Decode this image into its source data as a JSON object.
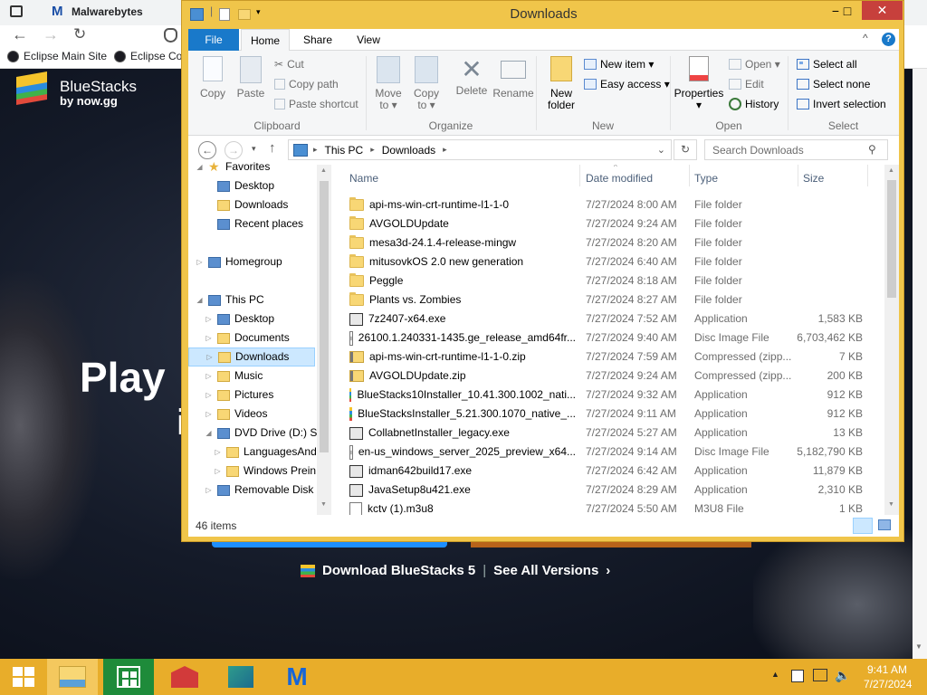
{
  "browser": {
    "tab_title": "Malwarebytes",
    "bookmarks": [
      "Eclipse Main Site",
      "Eclipse Co"
    ],
    "site_logo": {
      "name": "BlueStacks",
      "by": "by now.gg"
    },
    "hero_text": "Play",
    "hero_text2": "i",
    "download_link": "Download BlueStacks 5",
    "separator": "|",
    "versions_link": "See All Versions",
    "versions_chevron": "›"
  },
  "window": {
    "title": "Downloads",
    "controls": {
      "minimize": "−",
      "maximize": "□",
      "close": "✕"
    },
    "help": "?",
    "collapse": "^"
  },
  "ribbon": {
    "tabs": [
      "File",
      "Home",
      "Share",
      "View"
    ],
    "active_tab": "Home",
    "clipboard": {
      "copy": "Copy",
      "paste": "Paste",
      "cut": "Cut",
      "copy_path": "Copy path",
      "paste_shortcut": "Paste shortcut",
      "group": "Clipboard"
    },
    "organize": {
      "move_to": "Move",
      "move_to2": "to ▾",
      "copy_to": "Copy",
      "copy_to2": "to ▾",
      "delete": "Delete",
      "rename": "Rename",
      "group": "Organize"
    },
    "new": {
      "new_folder": "New",
      "new_folder2": "folder",
      "new_item": "New item ▾",
      "easy_access": "Easy access ▾",
      "group": "New"
    },
    "open": {
      "properties": "Properties",
      "properties_arrow": "▾",
      "open": "Open ▾",
      "edit": "Edit",
      "history": "History",
      "group": "Open"
    },
    "select": {
      "select_all": "Select all",
      "select_none": "Select none",
      "invert_selection": "Invert selection",
      "group": "Select"
    }
  },
  "address": {
    "path": [
      "This PC",
      "Downloads"
    ],
    "search_placeholder": "Search Downloads"
  },
  "nav_tree": [
    {
      "label": "Favorites",
      "indent": 0,
      "arrow": "◢",
      "icon": "star-icon"
    },
    {
      "label": "Desktop",
      "indent": 1,
      "arrow": "",
      "icon": "desktop-icon"
    },
    {
      "label": "Downloads",
      "indent": 1,
      "arrow": "",
      "icon": "downloads-folder-icon"
    },
    {
      "label": "Recent places",
      "indent": 1,
      "arrow": "",
      "icon": "recent-places-icon"
    },
    {
      "label": "Homegroup",
      "indent": 0,
      "arrow": "▷",
      "icon": "homegroup-icon"
    },
    {
      "label": "This PC",
      "indent": 0,
      "arrow": "◢",
      "icon": "computer-icon"
    },
    {
      "label": "Desktop",
      "indent": 1,
      "arrow": "▷",
      "icon": "desktop-icon"
    },
    {
      "label": "Documents",
      "indent": 1,
      "arrow": "▷",
      "icon": "documents-icon"
    },
    {
      "label": "Downloads",
      "indent": 1,
      "arrow": "▷",
      "icon": "downloads-folder-icon",
      "selected": true
    },
    {
      "label": "Music",
      "indent": 1,
      "arrow": "▷",
      "icon": "music-icon"
    },
    {
      "label": "Pictures",
      "indent": 1,
      "arrow": "▷",
      "icon": "pictures-icon"
    },
    {
      "label": "Videos",
      "indent": 1,
      "arrow": "▷",
      "icon": "videos-icon"
    },
    {
      "label": "DVD Drive (D:) SE",
      "indent": 1,
      "arrow": "◢",
      "icon": "dvd-drive-icon"
    },
    {
      "label": "LanguagesAnd",
      "indent": 2,
      "arrow": "▷",
      "icon": "folder-icon"
    },
    {
      "label": "Windows Prein",
      "indent": 2,
      "arrow": "▷",
      "icon": "folder-icon"
    },
    {
      "label": "Removable Disk (",
      "indent": 1,
      "arrow": "▷",
      "icon": "removable-disk-icon"
    }
  ],
  "columns": {
    "name": "Name",
    "date": "Date modified",
    "type": "Type",
    "size": "Size"
  },
  "files": [
    {
      "name": "api-ms-win-crt-runtime-l1-1-0",
      "date": "7/27/2024 8:00 AM",
      "type": "File folder",
      "size": "",
      "icon": "folder"
    },
    {
      "name": "AVGOLDUpdate",
      "date": "7/27/2024 9:24 AM",
      "type": "File folder",
      "size": "",
      "icon": "folder"
    },
    {
      "name": "mesa3d-24.1.4-release-mingw",
      "date": "7/27/2024 8:20 AM",
      "type": "File folder",
      "size": "",
      "icon": "folder"
    },
    {
      "name": "mitusovkOS 2.0 new generation",
      "date": "7/27/2024 6:40 AM",
      "type": "File folder",
      "size": "",
      "icon": "folder"
    },
    {
      "name": "Peggle",
      "date": "7/27/2024 8:18 AM",
      "type": "File folder",
      "size": "",
      "icon": "folder"
    },
    {
      "name": "Plants vs. Zombies",
      "date": "7/27/2024 8:27 AM",
      "type": "File folder",
      "size": "",
      "icon": "folder"
    },
    {
      "name": "7z2407-x64.exe",
      "date": "7/27/2024 7:52 AM",
      "type": "Application",
      "size": "1,583 KB",
      "icon": "app"
    },
    {
      "name": "26100.1.240331-1435.ge_release_amd64fr...",
      "date": "7/27/2024 9:40 AM",
      "type": "Disc Image File",
      "size": "6,703,462 KB",
      "icon": "disc"
    },
    {
      "name": "api-ms-win-crt-runtime-l1-1-0.zip",
      "date": "7/27/2024 7:59 AM",
      "type": "Compressed (zipp...",
      "size": "7 KB",
      "icon": "zip"
    },
    {
      "name": "AVGOLDUpdate.zip",
      "date": "7/27/2024 9:24 AM",
      "type": "Compressed (zipp...",
      "size": "200 KB",
      "icon": "zip"
    },
    {
      "name": "BlueStacks10Installer_10.41.300.1002_nati...",
      "date": "7/27/2024 9:32 AM",
      "type": "Application",
      "size": "912 KB",
      "icon": "bluestacks"
    },
    {
      "name": "BlueStacksInstaller_5.21.300.1070_native_...",
      "date": "7/27/2024 9:11 AM",
      "type": "Application",
      "size": "912 KB",
      "icon": "bluestacks"
    },
    {
      "name": "CollabnetInstaller_legacy.exe",
      "date": "7/27/2024 5:27 AM",
      "type": "Application",
      "size": "13 KB",
      "icon": "app"
    },
    {
      "name": "en-us_windows_server_2025_preview_x64...",
      "date": "7/27/2024 9:14 AM",
      "type": "Disc Image File",
      "size": "5,182,790 KB",
      "icon": "disc"
    },
    {
      "name": "idman642build17.exe",
      "date": "7/27/2024 6:42 AM",
      "type": "Application",
      "size": "11,879 KB",
      "icon": "app"
    },
    {
      "name": "JavaSetup8u421.exe",
      "date": "7/27/2024 8:29 AM",
      "type": "Application",
      "size": "2,310 KB",
      "icon": "app"
    },
    {
      "name": "kctv (1).m3u8",
      "date": "7/27/2024 5:50 AM",
      "type": "M3U8 File",
      "size": "1 KB",
      "icon": "file"
    }
  ],
  "status": {
    "items": "46 items"
  },
  "taskbar": {
    "apps": [
      "start-button",
      "file-explorer-icon",
      "store-icon",
      "app-red-icon",
      "app-teal-icon",
      "malwarebytes-icon"
    ],
    "time": "9:41 AM",
    "date": "7/27/2024"
  },
  "colors": {
    "accent": "#1979ca",
    "window_frame": "#f0c54a",
    "taskbar": "#e8ad2a"
  }
}
